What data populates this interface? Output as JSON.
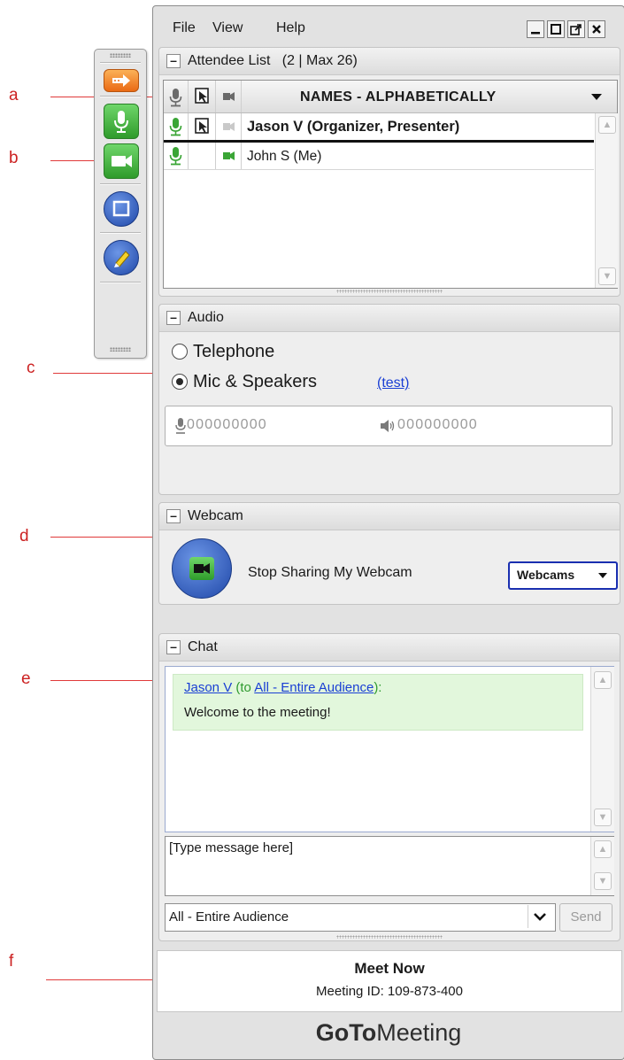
{
  "callouts": [
    "a",
    "b",
    "c",
    "d",
    "e",
    "f"
  ],
  "menu": {
    "file": "File",
    "view": "View",
    "help": "Help"
  },
  "window_controls": {
    "minimize_icon": "minimize-icon",
    "maximize_icon": "maximize-icon",
    "popout_icon": "popout-icon",
    "close_icon": "close-icon"
  },
  "attendee_list": {
    "title": "Attendee List",
    "count": "(2 | Max 26)",
    "sort_label": "NAMES - ALPHABETICALLY",
    "rows": [
      {
        "name": "Jason V (Organizer, Presenter)",
        "mic": "mic-icon",
        "presenter": true,
        "webcam_active": false
      },
      {
        "name": "John S (Me)",
        "mic": "mic-icon",
        "presenter": false,
        "webcam_active": true
      }
    ]
  },
  "audio": {
    "title": "Audio",
    "option_telephone": "Telephone",
    "option_mic": "Mic & Speakers",
    "selected": "Mic & Speakers",
    "test_link": "(test)",
    "mic_level": "000000000",
    "speaker_level": "000000000"
  },
  "webcam": {
    "title": "Webcam",
    "stop_label": "Stop Sharing My Webcam",
    "webcams_button": "Webcams"
  },
  "chat": {
    "title": "Chat",
    "messages": [
      {
        "sender": "Jason V",
        "to_prefix": "(to",
        "recipient": "All - Entire Audience",
        "to_suffix": "):",
        "text": "Welcome to the meeting!"
      }
    ],
    "input_placeholder": "[Type message here]",
    "recipient_select": "All - Entire Audience",
    "send_button": "Send"
  },
  "meeting": {
    "title": "Meet Now",
    "id_label": "Meeting ID: 109-873-400"
  },
  "brand": {
    "bold": "GoTo",
    "light": "Meeting"
  },
  "colors": {
    "accent_orange": "#f07a1e",
    "mic_green": "#3aa535",
    "button_blue": "#2a57b8",
    "link_blue": "#1a3fd4",
    "callout_red": "#e03a3a",
    "chat_highlight": "#e2f7dc"
  }
}
